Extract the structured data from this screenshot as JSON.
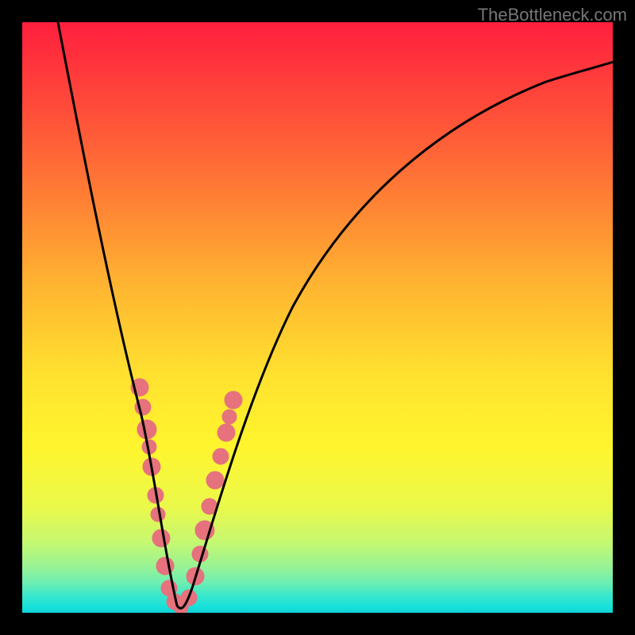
{
  "watermark": {
    "text": "TheBottleneck.com"
  },
  "colors": {
    "frame": "#000000",
    "curve": "#000000",
    "highlight": "#e5727c",
    "gradient_stops": [
      "#ff1f3e",
      "#ff4a3a",
      "#ff8034",
      "#ffb631",
      "#ffe22f",
      "#fff52e",
      "#eaf94a",
      "#c6f870",
      "#9af393",
      "#6ceeb2",
      "#3be7cb",
      "#18e2da",
      "#0fd0d8"
    ]
  },
  "chart_data": {
    "type": "line",
    "title": "",
    "xlabel": "",
    "ylabel": "",
    "xlim": [
      0,
      100
    ],
    "ylim": [
      0,
      100
    ],
    "grid": false,
    "series": [
      {
        "name": "curve",
        "x": [
          6,
          8,
          10,
          12,
          14,
          16,
          18,
          20,
          22,
          23,
          24,
          25,
          26,
          27,
          28,
          30,
          32,
          34,
          36,
          40,
          45,
          50,
          55,
          60,
          65,
          70,
          75,
          80,
          85,
          90,
          95,
          100
        ],
        "values": [
          100,
          92,
          83,
          74,
          65,
          56,
          47,
          37,
          25,
          18,
          10,
          4,
          1,
          1,
          4,
          12,
          22,
          31,
          39,
          51,
          61,
          68,
          74,
          78,
          82,
          84,
          87,
          89,
          90,
          92,
          93,
          94
        ],
        "note": "V-shaped curve; x and y are percent coordinates of the inner plot area (0,0 bottom-left)."
      }
    ],
    "highlight_ranges": [
      {
        "x_start": 19,
        "x_end": 23,
        "side": "left",
        "note": "pink bead cluster on left descending branch (upper)"
      },
      {
        "x_start": 23,
        "x_end": 27,
        "side": "left",
        "note": "pink bead cluster near trough / left side"
      },
      {
        "x_start": 27,
        "x_end": 33,
        "side": "right",
        "note": "pink bead cluster on right ascending branch"
      }
    ],
    "minimum_at_x": 26
  }
}
